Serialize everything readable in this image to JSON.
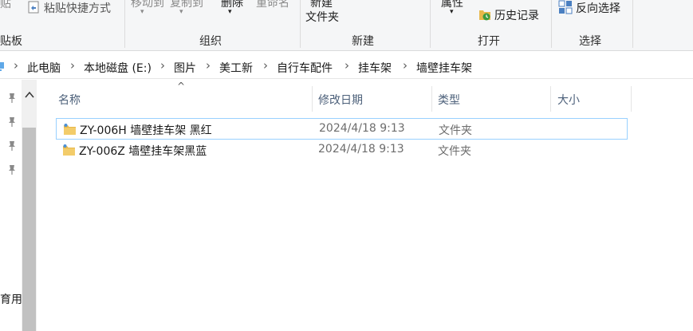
{
  "ribbon": {
    "clipboard_cut_label": "贴板",
    "paste_cut": "贴",
    "paste_shortcut": "粘贴快捷方式",
    "organize_move": "移动到",
    "organize_copy": "复制到",
    "organize_delete": "删除",
    "organize_rename": "重命名",
    "organize_label": "组织",
    "new_folder_line1": "新建",
    "new_folder_line2": "文件夹",
    "new_label": "新建",
    "open_properties": "属性",
    "open_history": "历史记录",
    "open_label": "打开",
    "select_invert": "反向选择",
    "select_label": "选择"
  },
  "address": {
    "crumbs": [
      "此电脑",
      "本地磁盘 (E:)",
      "图片",
      "美工新",
      "自行车配件",
      "挂车架",
      "墙壁挂车架"
    ]
  },
  "nav": {
    "partial_label": "育用"
  },
  "columns": {
    "name": "名称",
    "modified": "修改日期",
    "type": "类型",
    "size": "大小"
  },
  "files": [
    {
      "name": "ZY-006H 墙壁挂车架 黑红",
      "modified": "2024/4/18 9:13",
      "type": "文件夹",
      "selected": true
    },
    {
      "name": "ZY-006Z 墙壁挂车架黑蓝",
      "modified": "2024/4/18 9:13",
      "type": "文件夹",
      "selected": false
    }
  ],
  "colors": {
    "selection_border": "#99d1ff",
    "folder_yellow": "#e8b84a",
    "header_text": "#4c607a"
  }
}
